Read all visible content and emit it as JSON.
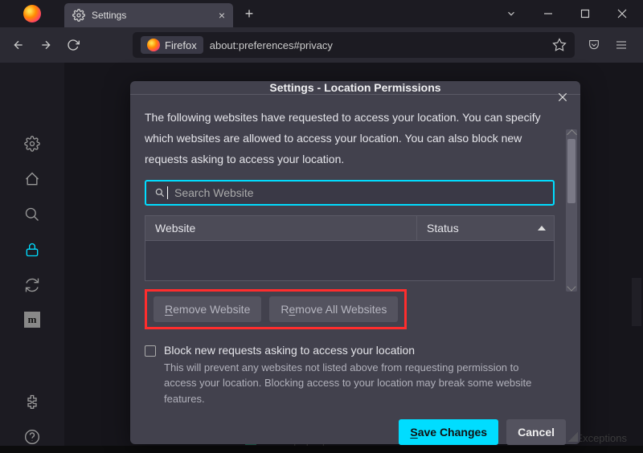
{
  "tab": {
    "title": "Settings"
  },
  "urlbar": {
    "identity": "Firefox",
    "url": "about:preferences#privacy"
  },
  "dialog": {
    "title": "Settings - Location Permissions",
    "description": "The following websites have requested to access your location. You can specify which websites are allowed to access your location. You can also block new requests asking to access your location.",
    "search_placeholder": "Search Website",
    "columns": {
      "website": "Website",
      "status": "Status"
    },
    "buttons": {
      "remove": "Remove Website",
      "remove_all": "Remove All Websites",
      "save": "Save Changes",
      "cancel": "Cancel"
    },
    "block_checkbox": {
      "label": "Block new requests asking to access your location",
      "help": "This will prevent any websites not listed above from requesting permission to access your location. Blocking access to your location may break some website features."
    }
  },
  "background": {
    "popup_text": "Block pop-up windows",
    "exceptions": "Exceptions"
  }
}
